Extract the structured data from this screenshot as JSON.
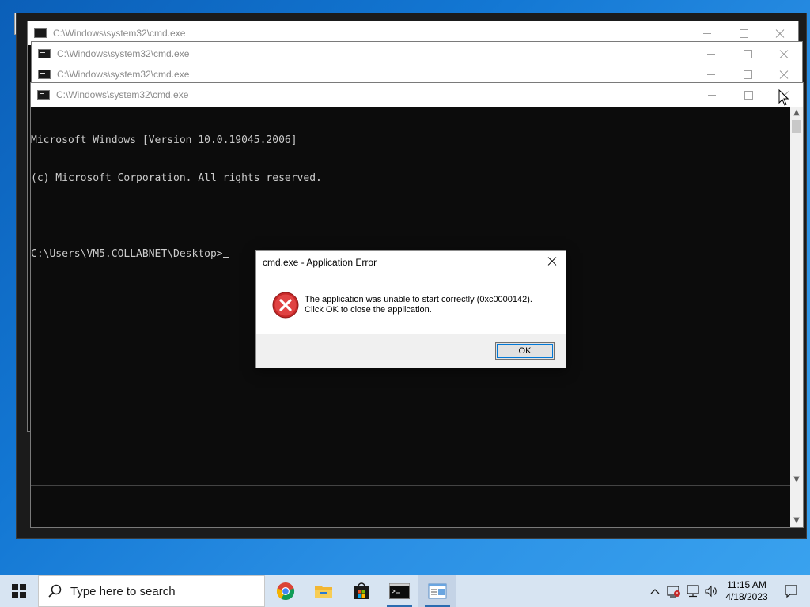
{
  "windows": {
    "title": "C:\\Windows\\system32\\cmd.exe",
    "background_titles": [
      "C:\\Windows\\system32\\cmd.exe",
      "C:\\Windows\\system32\\cmd.exe",
      "C:\\Windows\\system32\\cmd.exe"
    ]
  },
  "console": {
    "lines": [
      "Microsoft Windows [Version 10.0.19045.2006]",
      "(c) Microsoft Corporation. All rights reserved.",
      "",
      "C:\\Users\\VM5.COLLABNET\\Desktop>"
    ]
  },
  "dialog": {
    "title": "cmd.exe - Application Error",
    "message_line1": "The application was unable to start correctly (0xc0000142).",
    "message_line2": "Click OK to close the application.",
    "ok_label": "OK",
    "icon": "error-icon"
  },
  "taskbar": {
    "search_placeholder": "Type here to search",
    "apps": [
      "chrome-icon",
      "file-explorer-icon",
      "microsoft-store-icon",
      "cmd-icon",
      "notepad-icon"
    ],
    "clock_time": "11:15 AM",
    "clock_date": "4/18/2023",
    "tray_icons": [
      "chevron-up-icon",
      "network-warning-icon",
      "network-icon",
      "volume-icon"
    ]
  },
  "colors": {
    "console_bg": "#0c0c0c",
    "console_text": "#cccccc",
    "error_red": "#d32f2f",
    "taskbar": "#d7e4f2",
    "accent": "#0078d7"
  }
}
